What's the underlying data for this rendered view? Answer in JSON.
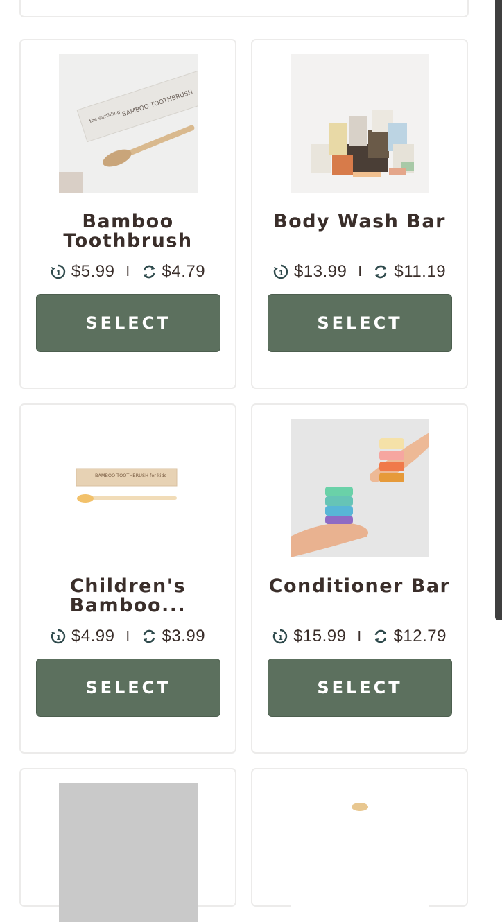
{
  "products": [
    {
      "title": "Bamboo Toothbrush",
      "price_once": "$5.99",
      "price_subscribe": "$4.79",
      "button": "SELECT",
      "image": "bamboo-toothbrush-box"
    },
    {
      "title": "Body Wash Bar",
      "price_once": "$13.99",
      "price_subscribe": "$11.19",
      "button": "SELECT",
      "image": "soap-bar-stack"
    },
    {
      "title": "Children's Bamboo...",
      "price_once": "$4.99",
      "price_subscribe": "$3.99",
      "button": "SELECT",
      "image": "kids-toothbrush-box"
    },
    {
      "title": "Conditioner Bar",
      "price_once": "$15.99",
      "price_subscribe": "$12.79",
      "button": "SELECT",
      "image": "conditioner-bars-hands"
    }
  ],
  "separator": "I",
  "colors": {
    "button": "#5c705e",
    "text": "#3a2e2a",
    "border": "#ecebea"
  }
}
